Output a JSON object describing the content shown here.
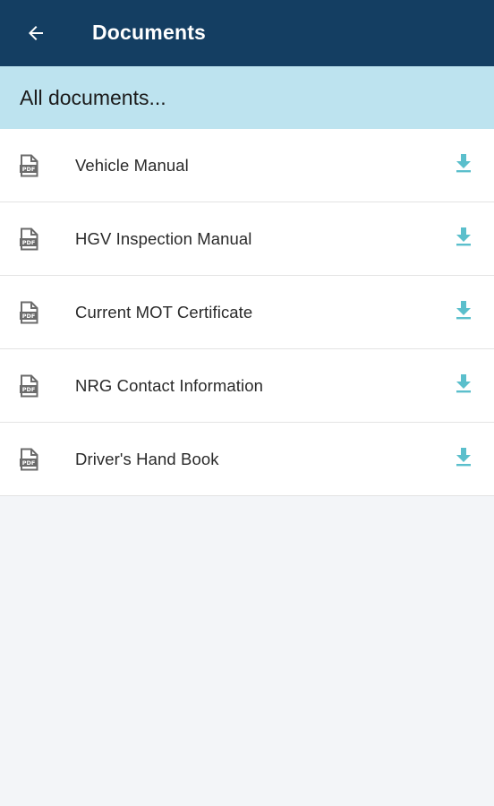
{
  "header": {
    "title": "Documents",
    "back_icon": "arrow-left-icon",
    "background_color": "#143e62"
  },
  "section": {
    "label": "All documents...",
    "background_color": "#bde3ef"
  },
  "documents": [
    {
      "name": "Vehicle Manual",
      "file_icon": "pdf-file-icon",
      "action_icon": "download-icon"
    },
    {
      "name": "HGV Inspection Manual",
      "file_icon": "pdf-file-icon",
      "action_icon": "download-icon"
    },
    {
      "name": "Current MOT Certificate",
      "file_icon": "pdf-file-icon",
      "action_icon": "download-icon"
    },
    {
      "name": "NRG Contact Information",
      "file_icon": "pdf-file-icon",
      "action_icon": "download-icon"
    },
    {
      "name": "Driver's Hand Book",
      "file_icon": "pdf-file-icon",
      "action_icon": "download-icon"
    }
  ],
  "colors": {
    "accent": "#5bbfcc",
    "page_background": "#f3f5f8"
  }
}
